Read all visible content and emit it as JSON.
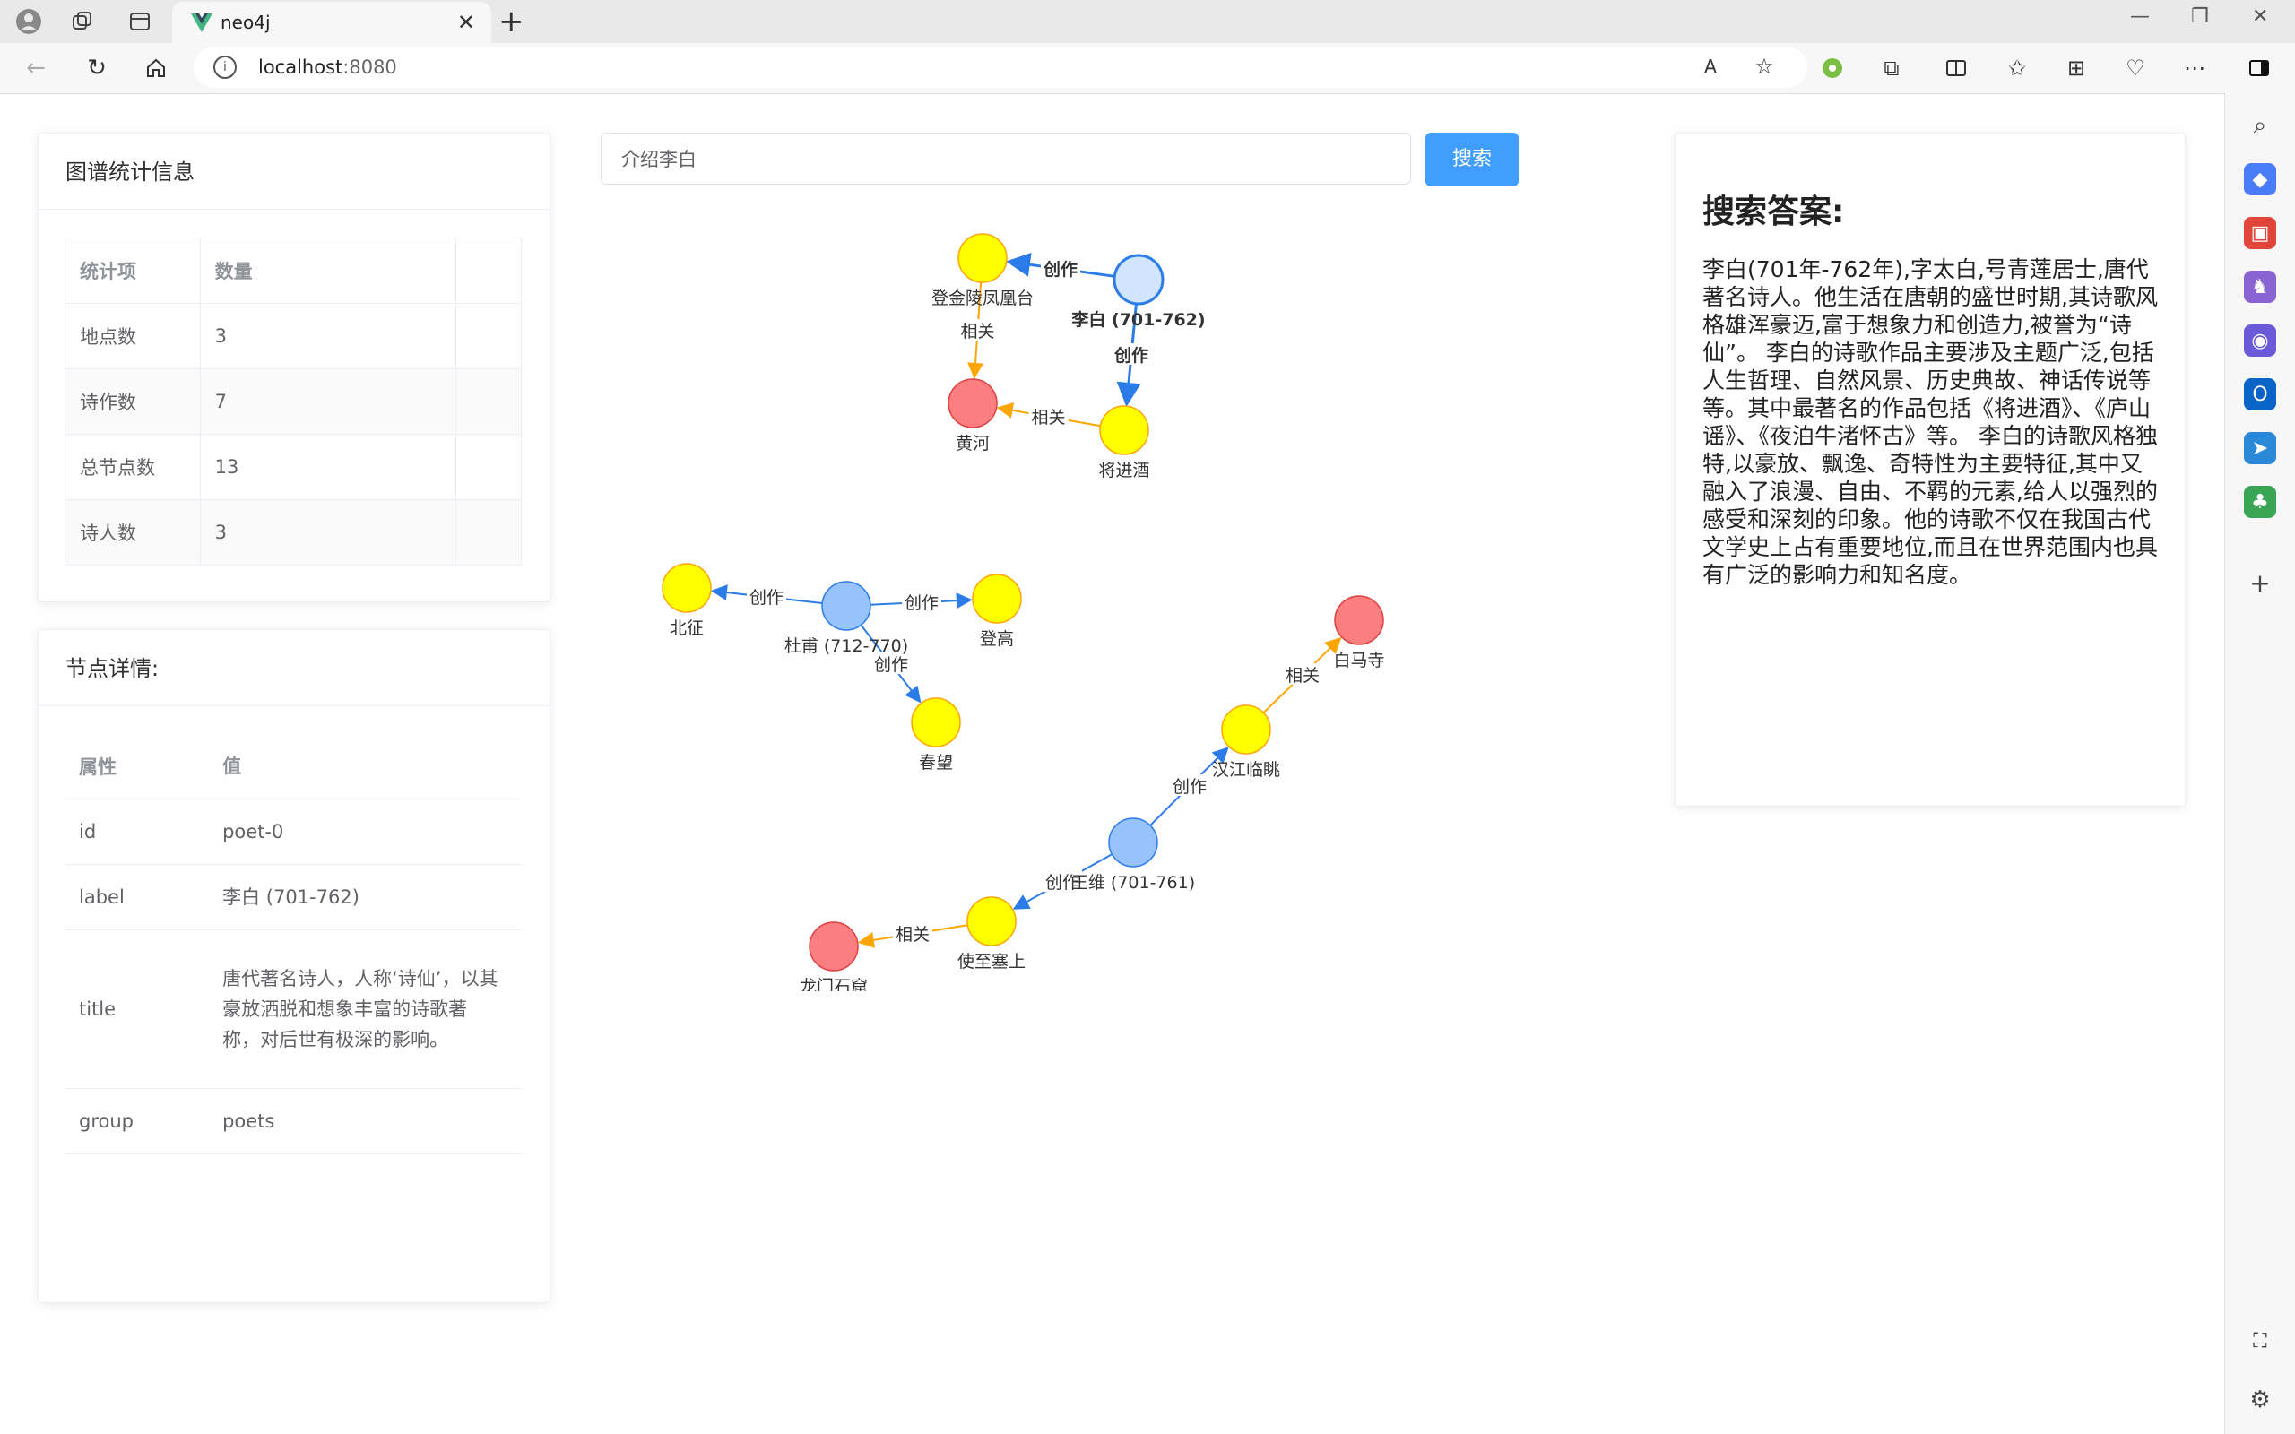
{
  "browser": {
    "tab_title": "neo4j",
    "url_host": "localhost",
    "url_port": ":8080"
  },
  "stats": {
    "title": "图谱统计信息",
    "headers": [
      "统计项",
      "数量"
    ],
    "rows": [
      {
        "name": "地点数",
        "value": "3"
      },
      {
        "name": "诗作数",
        "value": "7"
      },
      {
        "name": "总节点数",
        "value": "13"
      },
      {
        "name": "诗人数",
        "value": "3"
      }
    ]
  },
  "detail": {
    "title": "节点详情:",
    "headers": [
      "属性",
      "值"
    ],
    "rows": [
      {
        "key": "id",
        "value": "poet-0"
      },
      {
        "key": "label",
        "value": "李白 (701-762)"
      },
      {
        "key": "title",
        "value": "唐代著名诗人，人称‘诗仙’，以其豪放洒脱和想象丰富的诗歌著称，对后世有极深的影响。"
      },
      {
        "key": "group",
        "value": "poets"
      }
    ]
  },
  "search": {
    "query": "介绍李白",
    "button_label": "搜索"
  },
  "answer": {
    "title": "搜索答案:",
    "text": "李白(701年-762年),字太白,号青莲居士,唐代著名诗人。他生活在唐朝的盛世时期,其诗歌风格雄浑豪迈,富于想象力和创造力,被誉为“诗仙”。 李白的诗歌作品主要涉及主题广泛,包括人生哲理、自然风景、历史典故、神话传说等等。其中最著名的作品包括《将进酒》、《庐山谣》、《夜泊牛渚怀古》等。 李白的诗歌风格独特,以豪放、飘逸、奇特性为主要特征,其中又融入了浪漫、自由、不羁的元素,给人以强烈的感受和深刻的印象。他的诗歌不仅在我国古代文学史上占有重要地位,而且在世界范围内也具有广泛的影响力和知名度。"
  },
  "colors": {
    "poet": "#97c2fc",
    "poet_selected": "#d2e5ff",
    "poem": "#ffff00",
    "place": "#fb7e81",
    "edge_create": "#2b7ce9",
    "edge_related": "#ffa500",
    "accent": "#409eff"
  },
  "graph": {
    "nodes": [
      {
        "id": "libai",
        "label": "李白 (701-762)",
        "group": "poet",
        "selected": true
      },
      {
        "id": "dengjinling",
        "label": "登金陵凤凰台",
        "group": "poem"
      },
      {
        "id": "huanghe",
        "label": "黄河",
        "group": "place"
      },
      {
        "id": "qiangjinjiu",
        "label": "将进酒",
        "group": "poem"
      },
      {
        "id": "dufu",
        "label": "杜甫 (712-770)",
        "group": "poet"
      },
      {
        "id": "beizheng",
        "label": "北征",
        "group": "poem"
      },
      {
        "id": "denggao",
        "label": "登高",
        "group": "poem"
      },
      {
        "id": "chunwang",
        "label": "春望",
        "group": "poem"
      },
      {
        "id": "baimasi",
        "label": "白马寺",
        "group": "place"
      },
      {
        "id": "hanjiang",
        "label": "汉江临眺",
        "group": "poem"
      },
      {
        "id": "wangwei",
        "label": "王维 (701-761)",
        "group": "poet"
      },
      {
        "id": "shizhisaishang",
        "label": "使至塞上",
        "group": "poem"
      },
      {
        "id": "longmen",
        "label": "龙门石窟",
        "group": "place"
      }
    ],
    "edges": [
      {
        "from": "libai",
        "to": "dengjinling",
        "label": "创作",
        "type": "create"
      },
      {
        "from": "libai",
        "to": "qiangjinjiu",
        "label": "创作",
        "type": "create"
      },
      {
        "from": "dengjinling",
        "to": "huanghe",
        "label": "相关",
        "type": "related"
      },
      {
        "from": "qiangjinjiu",
        "to": "huanghe",
        "label": "相关",
        "type": "related"
      },
      {
        "from": "dufu",
        "to": "beizheng",
        "label": "创作",
        "type": "create"
      },
      {
        "from": "dufu",
        "to": "denggao",
        "label": "创作",
        "type": "create"
      },
      {
        "from": "dufu",
        "to": "chunwang",
        "label": "创作",
        "type": "create"
      },
      {
        "from": "wangwei",
        "to": "hanjiang",
        "label": "创作",
        "type": "create"
      },
      {
        "from": "hanjiang",
        "to": "baimasi",
        "label": "相关",
        "type": "related"
      },
      {
        "from": "wangwei",
        "to": "shizhisaishang",
        "label": "创作",
        "type": "create"
      },
      {
        "from": "shizhisaishang",
        "to": "longmen",
        "label": "相关",
        "type": "related"
      }
    ]
  }
}
